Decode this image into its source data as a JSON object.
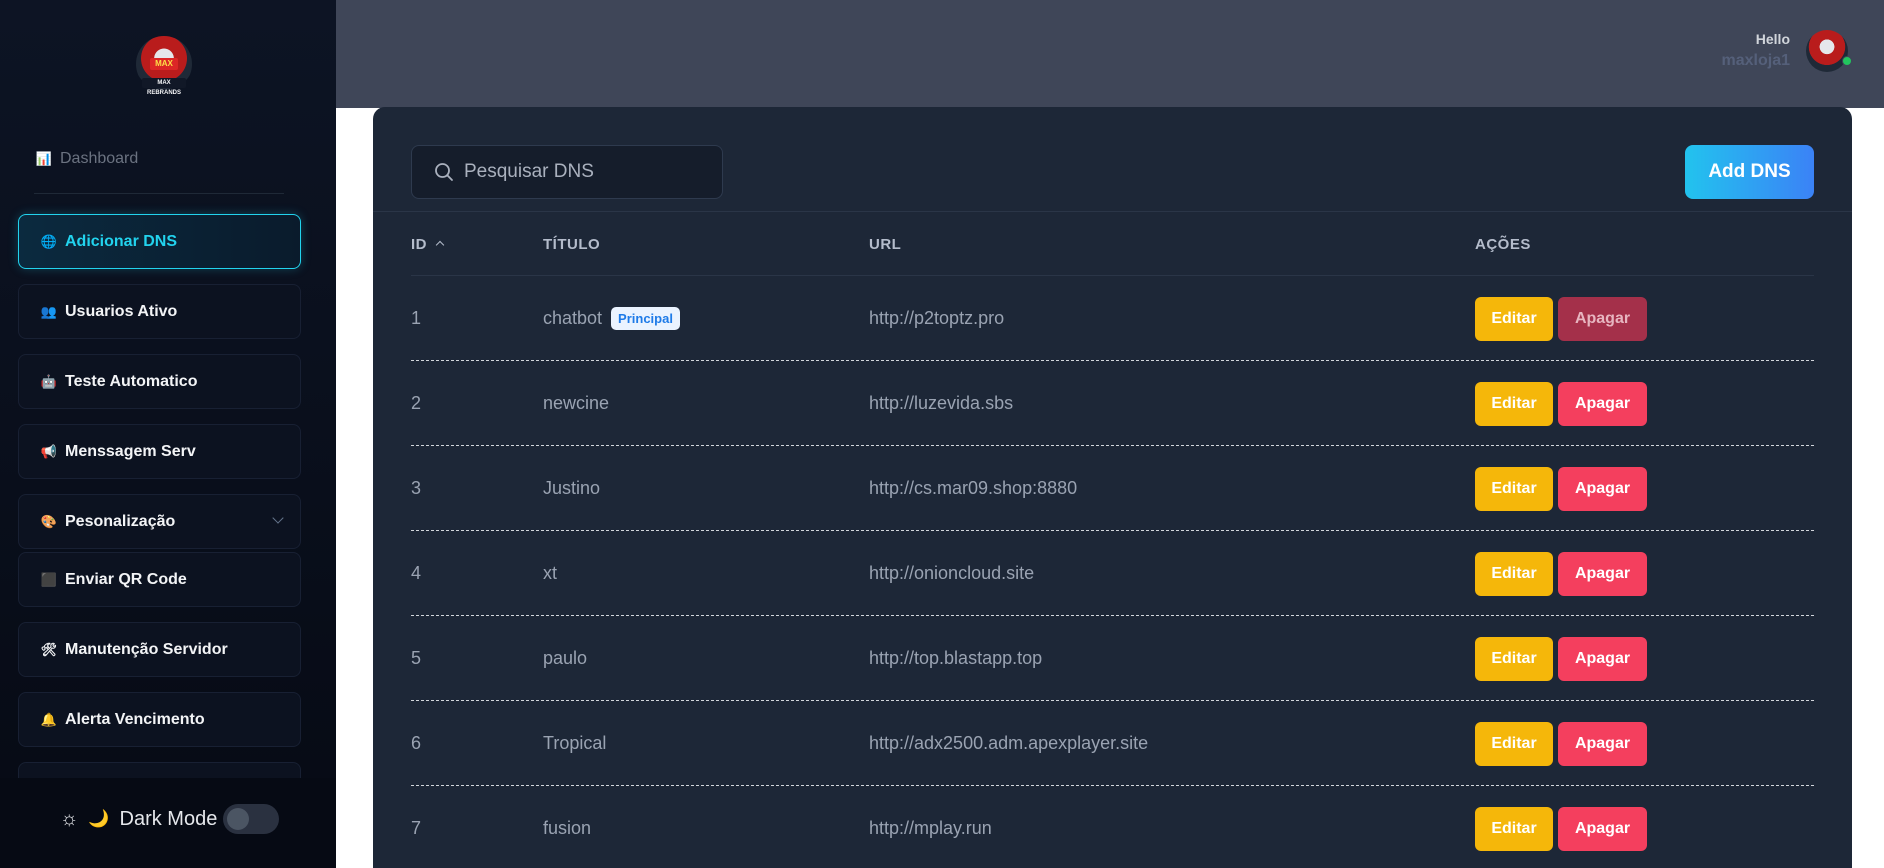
{
  "sidebar": {
    "logo_text": "MAX REBRANDS",
    "dashboard": {
      "icon": "📊",
      "label": "Dashboard"
    },
    "items": [
      {
        "icon": "🌐",
        "label": "Adicionar DNS",
        "active": true
      },
      {
        "icon": "👥",
        "label": "Usuarios Ativo"
      },
      {
        "icon": "🤖",
        "label": "Teste Automatico"
      },
      {
        "icon": "📢",
        "label": "Menssagem Serv"
      },
      {
        "icon": "🎨",
        "label": "Pesonalização",
        "dropdown": true
      },
      {
        "icon": "⬛",
        "label": "Enviar QR Code"
      },
      {
        "icon": "🛠",
        "label": "Manutenção Servidor"
      },
      {
        "icon": "🔔",
        "label": "Alerta Vencimento"
      }
    ],
    "dark_mode": {
      "sun_icon": "☼",
      "moon_icon": "🌙",
      "label": "Dark Mode",
      "enabled": false
    }
  },
  "header": {
    "greeting": "Hello",
    "username": "maxloja1",
    "online": true
  },
  "toolbar": {
    "search_placeholder": "Pesquisar DNS",
    "add_label": "Add DNS"
  },
  "table": {
    "columns": [
      "ID",
      "TÍTULO",
      "URL",
      "AÇÕES"
    ],
    "edit_label": "Editar",
    "delete_label": "Apagar",
    "rows": [
      {
        "id": "1",
        "title": "chatbot",
        "badge": "Principal",
        "url": "http://p2toptz.pro",
        "delete_disabled": true
      },
      {
        "id": "2",
        "title": "newcine",
        "url": "http://luzevida.sbs"
      },
      {
        "id": "3",
        "title": "Justino",
        "url": "http://cs.mar09.shop:8880"
      },
      {
        "id": "4",
        "title": "xt",
        "url": "http://onioncloud.site"
      },
      {
        "id": "5",
        "title": "paulo",
        "url": "http://top.blastapp.top"
      },
      {
        "id": "6",
        "title": "Tropical",
        "url": "http://adx2500.adm.apexplayer.site"
      },
      {
        "id": "7",
        "title": "fusion",
        "url": "http://mplay.run"
      }
    ]
  },
  "colors": {
    "accent": "#22d3ee",
    "edit": "#f5b70a",
    "delete": "#f43f5e",
    "card": "#1d2737",
    "sidebar": "#0d1424"
  }
}
